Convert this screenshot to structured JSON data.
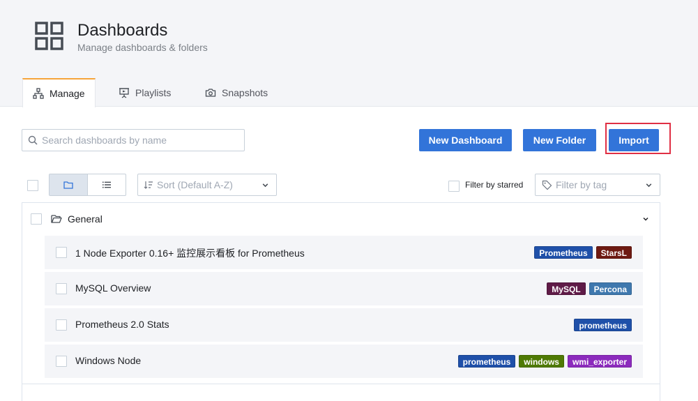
{
  "header": {
    "title": "Dashboards",
    "subtitle": "Manage dashboards & folders",
    "icon": "dashboard-grid-icon"
  },
  "tabs": [
    {
      "label": "Manage",
      "icon": "sitemap-icon",
      "active": true
    },
    {
      "label": "Playlists",
      "icon": "presentation-icon",
      "active": false
    },
    {
      "label": "Snapshots",
      "icon": "camera-icon",
      "active": false
    }
  ],
  "search": {
    "placeholder": "Search dashboards by name",
    "value": ""
  },
  "actions": {
    "new_dashboard": "New Dashboard",
    "new_folder": "New Folder",
    "import": "Import"
  },
  "toolbar": {
    "sort_placeholder": "Sort (Default A-Z)",
    "filter_starred_label": "Filter by starred",
    "filter_tag_placeholder": "Filter by tag"
  },
  "folder": {
    "name": "General",
    "dashboards": [
      {
        "name": "1 Node Exporter 0.16+ 监控展示看板 for Prometheus",
        "tags": [
          {
            "label": "Prometheus",
            "color": "#1f50a9"
          },
          {
            "label": "StarsL",
            "color": "#6e1a12"
          }
        ]
      },
      {
        "name": "MySQL Overview",
        "tags": [
          {
            "label": "MySQL",
            "color": "#5f1b47"
          },
          {
            "label": "Percona",
            "color": "#3f78ae"
          }
        ]
      },
      {
        "name": "Prometheus 2.0 Stats",
        "tags": [
          {
            "label": "prometheus",
            "color": "#1f50a9"
          }
        ]
      },
      {
        "name": "Windows Node",
        "tags": [
          {
            "label": "prometheus",
            "color": "#1f50a9"
          },
          {
            "label": "windows",
            "color": "#4f7a04"
          },
          {
            "label": "wmi_exporter",
            "color": "#8c2bbd"
          }
        ]
      }
    ]
  },
  "colors": {
    "primary_button": "#3274d9",
    "active_tab_accent": "#f6a43a",
    "highlight_box": "#e02f44"
  }
}
